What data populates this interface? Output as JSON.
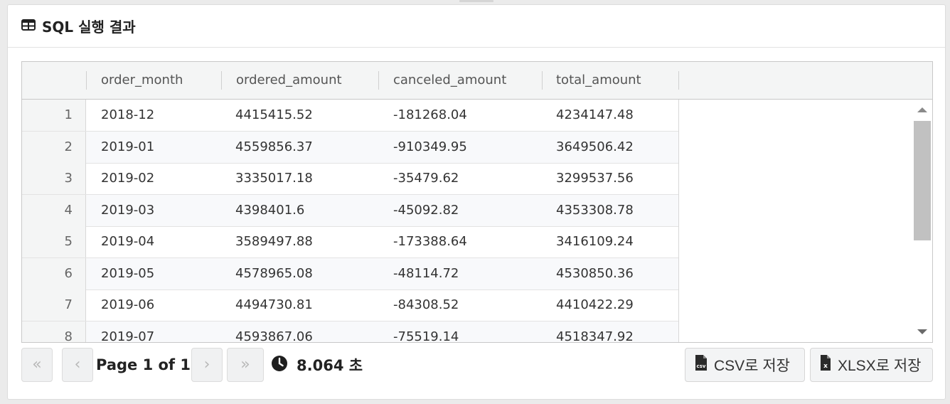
{
  "panel": {
    "title": "SQL 실행 결과",
    "icon": "table-icon"
  },
  "grid": {
    "columns": [
      "order_month",
      "ordered_amount",
      "canceled_amount",
      "total_amount"
    ],
    "rows": [
      {
        "index": "1",
        "order_month": "2018-12",
        "ordered_amount": "4415415.52",
        "canceled_amount": "-181268.04",
        "total_amount": "4234147.48"
      },
      {
        "index": "2",
        "order_month": "2019-01",
        "ordered_amount": "4559856.37",
        "canceled_amount": "-910349.95",
        "total_amount": "3649506.42"
      },
      {
        "index": "3",
        "order_month": "2019-02",
        "ordered_amount": "3335017.18",
        "canceled_amount": "-35479.62",
        "total_amount": "3299537.56"
      },
      {
        "index": "4",
        "order_month": "2019-03",
        "ordered_amount": "4398401.6",
        "canceled_amount": "-45092.82",
        "total_amount": "4353308.78"
      },
      {
        "index": "5",
        "order_month": "2019-04",
        "ordered_amount": "3589497.88",
        "canceled_amount": "-173388.64",
        "total_amount": "3416109.24"
      },
      {
        "index": "6",
        "order_month": "2019-05",
        "ordered_amount": "4578965.08",
        "canceled_amount": "-48114.72",
        "total_amount": "4530850.36"
      },
      {
        "index": "7",
        "order_month": "2019-06",
        "ordered_amount": "4494730.81",
        "canceled_amount": "-84308.52",
        "total_amount": "4410422.29"
      },
      {
        "index": "8",
        "order_month": "2019-07",
        "ordered_amount": "4593867.06",
        "canceled_amount": "-75519.14",
        "total_amount": "4518347.92"
      }
    ]
  },
  "pagination": {
    "first_label": "«",
    "prev_label": "‹",
    "next_label": "›",
    "last_label": "»",
    "page_info": "Page 1 of 1"
  },
  "elapsed": {
    "text": "8.064 초",
    "icon": "clock-icon"
  },
  "export": {
    "csv_label": "CSV로 저장",
    "csv_icon": "csv-file-icon",
    "xlsx_label": "XLSX로 저장",
    "xlsx_icon": "excel-file-icon"
  }
}
